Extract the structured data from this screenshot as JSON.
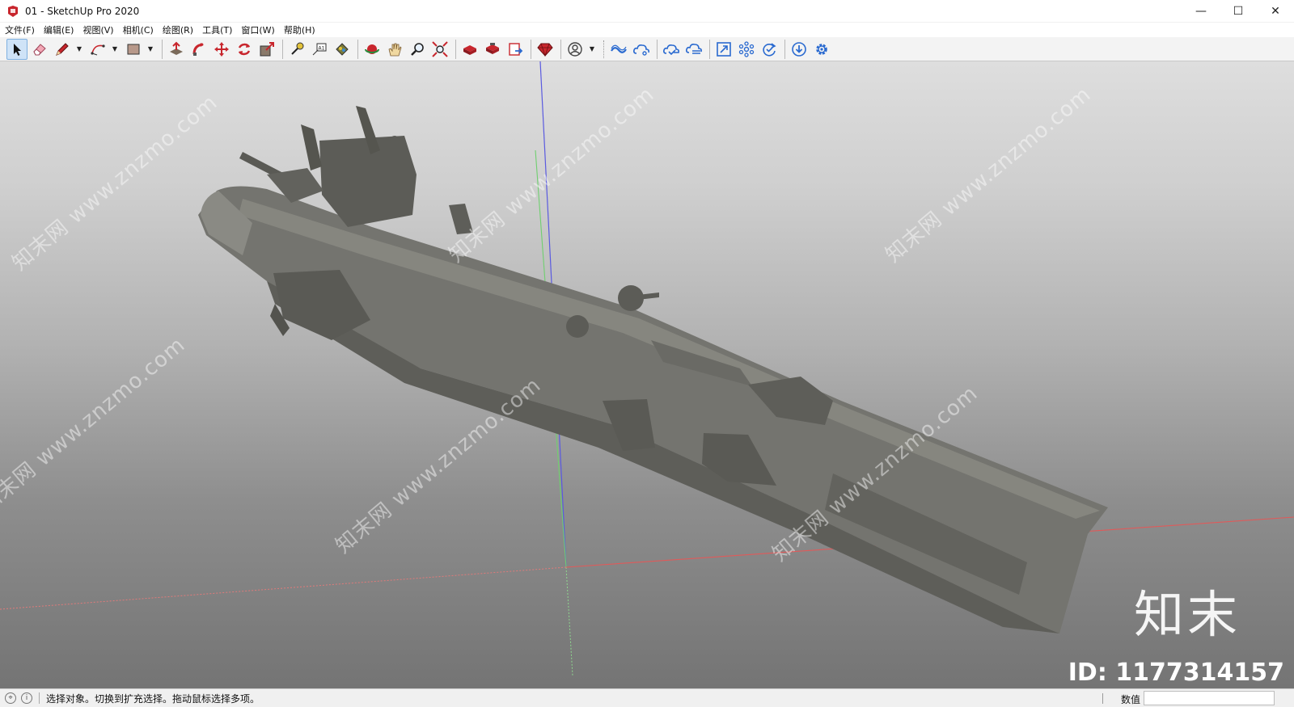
{
  "window": {
    "title": "01 - SketchUp Pro 2020",
    "minimize": "—",
    "maximize": "☐",
    "close": "✕"
  },
  "menus": [
    "文件(F)",
    "编辑(E)",
    "视图(V)",
    "相机(C)",
    "绘图(R)",
    "工具(T)",
    "窗口(W)",
    "帮助(H)"
  ],
  "toolbar": {
    "tools": [
      "select-tool",
      "eraser-tool",
      "pencil-line-tool",
      "arc-tool",
      "rectangle-tool",
      "push-pull-tool",
      "follow-me-tool",
      "move-tool",
      "rotate-tool",
      "scale-tool",
      "tape-measure-tool",
      "text-tool",
      "paint-bucket-tool",
      "orbit-tool",
      "pan-tool",
      "zoom-tool",
      "zoom-extents-tool",
      "warehouse-tool",
      "extension-warehouse-tool",
      "send-to-layout-tool",
      "extension-manager-tool",
      "account-tool",
      "trimble-connect-tool",
      "share-model-tool",
      "collaborate-tool",
      "sync-tool",
      "zoom-window-tool",
      "components-tool",
      "sync-update-tool",
      "download-tool",
      "settings-tool"
    ]
  },
  "colors": {
    "axis_red": "#e05a5a",
    "axis_green": "#6fcf6f",
    "axis_blue": "#5a5ae0",
    "ship": "#6e6e6a",
    "ship_dark": "#55554f",
    "accent_red": "#c8262d"
  },
  "watermark": {
    "text": "知末网 www.znzmo.com",
    "logo": "知末",
    "id": "ID: 1177314157"
  },
  "status": {
    "message": "选择对象。切换到扩充选择。拖动鼠标选择多项。",
    "measure_label": "数值",
    "measure_value": ""
  }
}
